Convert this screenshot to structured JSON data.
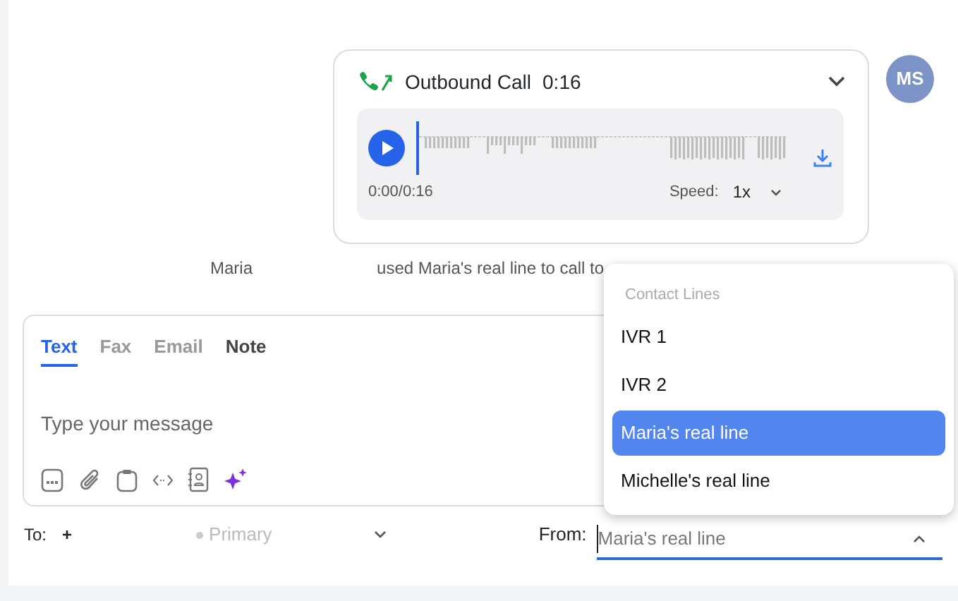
{
  "call": {
    "title": "Outbound Call",
    "duration": "0:16",
    "player": {
      "level": 0,
      "time": "0:00/0:16",
      "speed_label": "Speed:",
      "speed": "1x"
    }
  },
  "avatar": {
    "initials": "MS"
  },
  "activity": {
    "actor": "Maria",
    "text": "used Maria's real line to call to"
  },
  "composer": {
    "tabs": [
      {
        "label": "Text",
        "selected": true,
        "disabled": false
      },
      {
        "label": "Fax",
        "selected": false,
        "disabled": true
      },
      {
        "label": "Email",
        "selected": false,
        "disabled": true
      },
      {
        "label": "Note",
        "selected": false,
        "disabled": false
      }
    ],
    "placeholder": "Type your message"
  },
  "to": {
    "label": "To:",
    "value": "+",
    "type": "Primary"
  },
  "from": {
    "label": "From:",
    "value": "Maria's real line",
    "open": true
  },
  "dropdown": {
    "header": "Contact Lines",
    "items": [
      {
        "label": "IVR 1",
        "selected": false
      },
      {
        "label": "IVR 2",
        "selected": false
      },
      {
        "label": "Maria's real line",
        "selected": true
      },
      {
        "label": "Michelle's real line",
        "selected": false
      }
    ]
  }
}
